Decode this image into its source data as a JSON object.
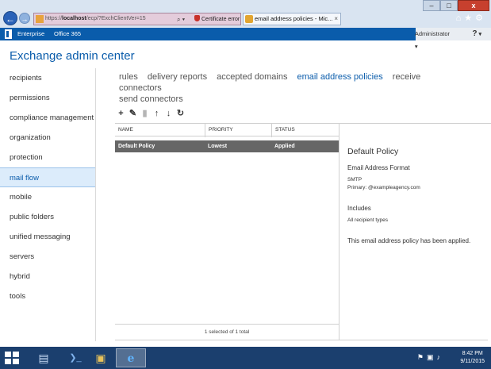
{
  "browser": {
    "address_prefix": "https://",
    "address_host": "localhost",
    "address_path": "/ecp/?ExchClientVer=15",
    "address_tools": "⌕ ▾",
    "cert_error": "Certificate error",
    "tab_title": "email address policies - Mic...",
    "tab_close": "×",
    "window_buttons": {
      "minimize": "–",
      "maximize": "□",
      "close": "x"
    },
    "nav_back": "←",
    "nav_forward": "→",
    "right_icons": "⌂★⚙"
  },
  "o365": {
    "enterprise": "Enterprise",
    "office365": "Office 365",
    "admin": "Administrator",
    "help": "?"
  },
  "app": {
    "title": "Exchange admin center"
  },
  "left_nav": [
    "recipients",
    "permissions",
    "compliance management",
    "organization",
    "protection",
    "mail flow",
    "mobile",
    "public folders",
    "unified messaging",
    "servers",
    "hybrid",
    "tools"
  ],
  "left_nav_selected": "mail flow",
  "tabs": {
    "rules": "rules",
    "delivery_reports": "delivery reports",
    "accepted_domains": "accepted domains",
    "email_address_policies": "email address policies",
    "receive_connectors": "receive connectors",
    "send_connectors": "send connectors"
  },
  "toolbar": {
    "add": "+",
    "edit": "✎",
    "delete": "▮",
    "move_up": "↑",
    "move_down": "↓",
    "refresh": "↻"
  },
  "table": {
    "columns": [
      "NAME",
      "PRIORITY",
      "STATUS"
    ],
    "rows": [
      {
        "name": "Default Policy",
        "priority": "Lowest",
        "status": "Applied"
      }
    ],
    "status_text": "1 selected of 1 total"
  },
  "details": {
    "title": "Default Policy",
    "format_label": "Email Address Format",
    "smtp": "SMTP",
    "primary": "Primary: @exampleagency.com",
    "includes_label": "Includes",
    "includes_value": "All recipient types",
    "applied_text": "This email address policy has been applied."
  },
  "taskbar": {
    "time": "8:42 PM",
    "date": "9/11/2015",
    "apps": [
      "▤",
      "❯_",
      "▣",
      "e"
    ],
    "tray": "⚑▣♪"
  },
  "colors": {
    "accent": "#0a5cab",
    "selected_row": "#666666",
    "nav_selected_bg": "#dcecfb",
    "taskbar": "#1b3f6e"
  }
}
